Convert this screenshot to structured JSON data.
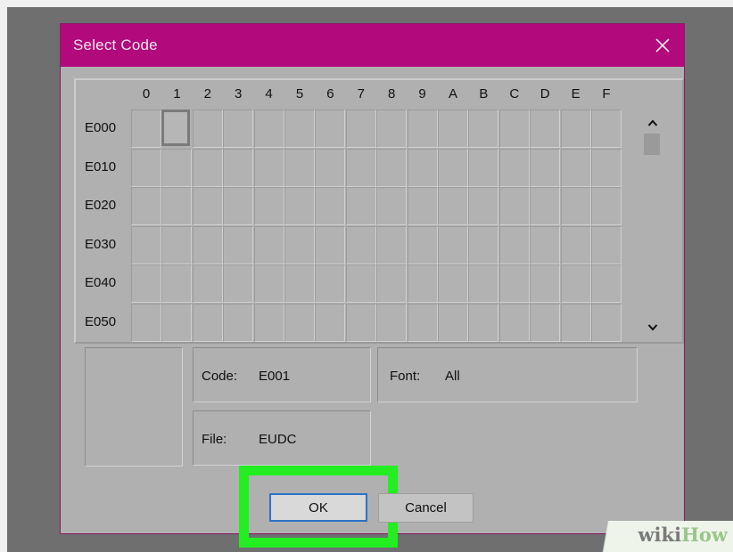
{
  "dialog": {
    "title": "Select Code",
    "close_icon": "close-icon",
    "accent_color": "#b20a7c"
  },
  "grid": {
    "column_headers": [
      "0",
      "1",
      "2",
      "3",
      "4",
      "5",
      "6",
      "7",
      "8",
      "9",
      "A",
      "B",
      "C",
      "D",
      "E",
      "F"
    ],
    "row_headers": [
      "E000",
      "E010",
      "E020",
      "E030",
      "E040",
      "E050"
    ],
    "selected_cell": "E001"
  },
  "scrollbar": {
    "up_icon": "chevron-up-icon",
    "down_icon": "chevron-down-icon",
    "up_glyph": "^",
    "down_glyph": "⌄"
  },
  "info": {
    "code_label": "Code:",
    "code_value": "E001",
    "font_label": "Font:",
    "font_value": "All",
    "file_label": "File:",
    "file_value": "EUDC"
  },
  "buttons": {
    "ok_label": "OK",
    "cancel_label": "Cancel"
  },
  "highlight": {
    "color": "#22ee22"
  },
  "watermark": {
    "part1": "wiki",
    "part2": "How"
  }
}
